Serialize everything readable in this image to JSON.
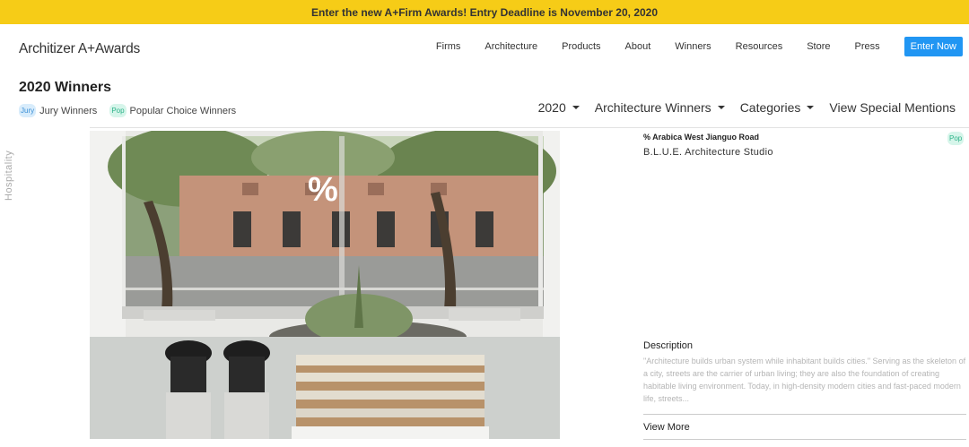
{
  "banner": {
    "text": "Enter the new A+Firm Awards! Entry Deadline is November 20, 2020"
  },
  "logo": {
    "text": "Architizer A+Awards"
  },
  "nav": {
    "links": [
      "Firms",
      "Architecture",
      "Products",
      "About",
      "Winners",
      "Resources",
      "Store",
      "Press"
    ],
    "cta": "Enter Now"
  },
  "page": {
    "title": "2020 Winners",
    "legend": {
      "jury_badge": "Jury",
      "jury_label": "Jury Winners",
      "pop_badge": "Pop",
      "pop_label": "Popular Choice Winners"
    }
  },
  "filters": {
    "year": "2020",
    "type": "Architecture Winners",
    "categories": "Categories",
    "special": "View Special Mentions"
  },
  "side_category": "Hospitality",
  "photo": {
    "sign": "%"
  },
  "project": {
    "name": "% Arabica West Jianguo Road",
    "badge": "Pop",
    "firm": "B.L.U.E. Architecture Studio",
    "description_title": "Description",
    "description": "\"Architecture builds urban system while inhabitant builds cities.\" Serving as the skeleton of a city, streets are the carrier of urban living; they are also the foundation of creating habitable living environment. Today, in high-density modern cities and fast-paced modern life, streets...",
    "view_more": "View More"
  },
  "colors": {
    "banner": "#f6cc17",
    "cta": "#2196f3",
    "jury": "#3a8fd6",
    "pop": "#2fb38a"
  }
}
